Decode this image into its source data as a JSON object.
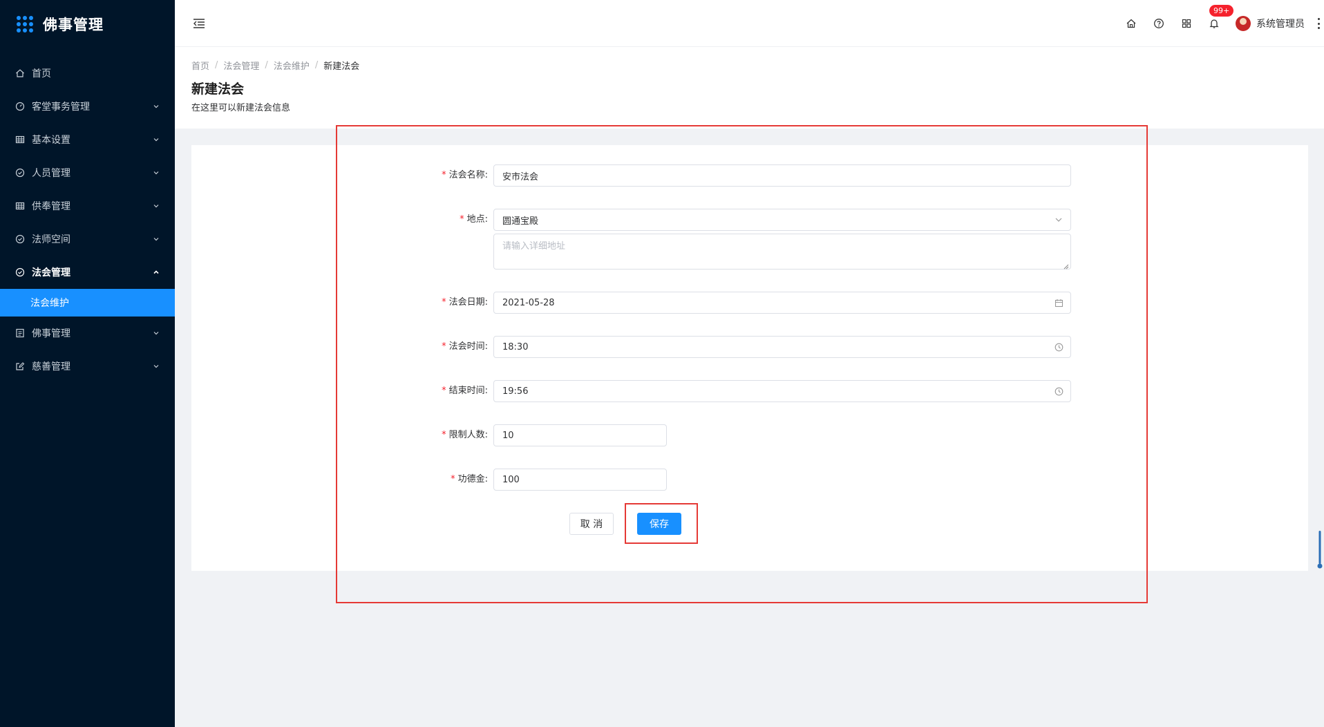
{
  "app": {
    "title": "佛事管理",
    "accent_color": "#1890ff",
    "sidebar_bg": "#001529"
  },
  "sidebar": {
    "items": [
      {
        "label": "首页",
        "icon": "home-icon",
        "has_arrow": false
      },
      {
        "label": "客堂事务管理",
        "icon": "dashboard-icon",
        "has_arrow": true
      },
      {
        "label": "基本设置",
        "icon": "table-icon",
        "has_arrow": true
      },
      {
        "label": "人员管理",
        "icon": "check-circle-icon",
        "has_arrow": true
      },
      {
        "label": "供奉管理",
        "icon": "table-icon",
        "has_arrow": true
      },
      {
        "label": "法师空间",
        "icon": "check-circle-icon",
        "has_arrow": true
      },
      {
        "label": "法会管理",
        "icon": "check-circle-icon",
        "has_arrow": true,
        "open": true
      },
      {
        "label": "佛事管理",
        "icon": "list-icon",
        "has_arrow": true
      },
      {
        "label": "慈善管理",
        "icon": "edit-icon",
        "has_arrow": true
      }
    ],
    "active_sub": "法会维护"
  },
  "header": {
    "notification_badge": "99+",
    "user_name": "系统管理员"
  },
  "breadcrumb": [
    "首页",
    "法会管理",
    "法会维护",
    "新建法会"
  ],
  "page": {
    "title": "新建法会",
    "description": "在这里可以新建法会信息"
  },
  "form": {
    "name": {
      "label": "法会名称:",
      "value": "安市法会"
    },
    "location": {
      "label": "地点:",
      "value": "圆通宝殿",
      "detail_placeholder": "请输入详细地址"
    },
    "date": {
      "label": "法会日期:",
      "value": "2021-05-28"
    },
    "start_time": {
      "label": "法会时间:",
      "value": "18:30"
    },
    "end_time": {
      "label": "结束时间:",
      "value": "19:56"
    },
    "limit": {
      "label": "限制人数:",
      "value": "10"
    },
    "merit": {
      "label": "功德金:",
      "value": "100"
    },
    "required_mark": "*",
    "cancel_label": "取 消",
    "save_label": "保存"
  }
}
